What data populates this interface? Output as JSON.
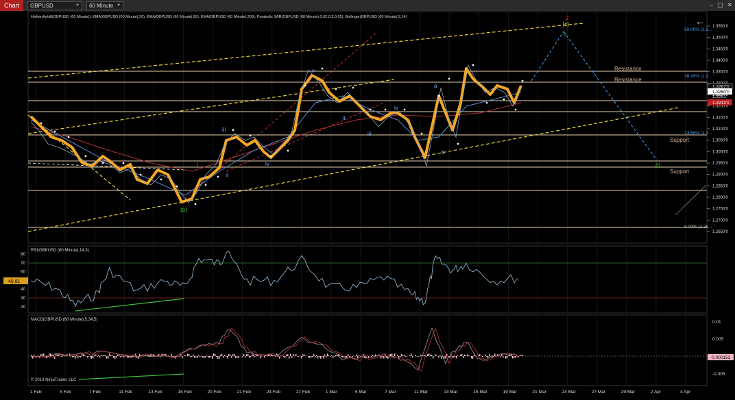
{
  "app": {
    "title": "Chart",
    "instrument": "GBPUSD",
    "interval": "60 Minute",
    "copyright": "© 2019 NinjaTrader, LLC"
  },
  "panels": {
    "price": {
      "indicators_label": "HeikenAshi8(GBPUSD (60 Minute)), EMA(GBPUSD (60 Minute),20), EMA(GBPUSD (60 Minute),50), EMA(GBPUSD (60 Minute),200), Parabolic SAR(GBPUSD (60 Minute),0.02,0.2,0.02), Bollinger(GBPUSD (60 Minute),2,14)",
      "y_ticks": [
        "1.3550'0",
        "1.3500'0",
        "1.3450'0",
        "1.3400'0",
        "1.3350'0",
        "1.3300'0",
        "1.3250'0",
        "1.3200'0",
        "1.3150'0",
        "1.3100'0",
        "1.3050'0",
        "1.3000'0",
        "1.2950'0",
        "1.2900'0",
        "1.2850'0",
        "1.2800'0",
        "1.2750'0",
        "1.2700'0",
        "1.2650'0"
      ],
      "y_range": [
        1.2625,
        1.358
      ],
      "price_tags": {
        "last": "1.3260'0",
        "ema": "1.3213'1",
        "top": "1.3267'0",
        "mid": "1.3251'"
      },
      "fib_labels": {
        "f50": "50.00% (1.3...",
        "f38": "38.20% (1.3...",
        "f23": "23.60% (1.3...",
        "f0": "0.00% (1.26..."
      },
      "sr_labels": {
        "r1": "Resistance",
        "r2": "Resistance",
        "s1": "Support",
        "s2": "Support"
      },
      "wave_labels": {
        "b": "(b)",
        "c": "[c]",
        "two": "2",
        "cc": "c",
        "i": "i",
        "ii": "ii",
        "iii": "iii",
        "iv": "iv",
        "v": "v",
        "a": "a",
        "bb": "b",
        "iii2": "iii",
        "iv2": "iv",
        "one": "(i)",
        "ii2": "ii"
      }
    },
    "rsi": {
      "label": "RSI(GBPUSD (60 Minute),14,3)",
      "y_ticks": [
        "80",
        "70",
        "60",
        "50",
        "40",
        "30",
        "20"
      ],
      "value_tag": "49.81"
    },
    "macd": {
      "label": "MACD(GBPUSD (60 Minute),5,34,5)",
      "y_ticks": [
        "0.01",
        "0.005",
        "0",
        "-0.005"
      ],
      "value_tag": "-0.000152"
    }
  },
  "x_axis": {
    "labels": [
      "1 Feb",
      "5 Feb",
      "7 Feb",
      "11 Feb",
      "13 Feb",
      "15 Feb",
      "20 Feb",
      "21 Feb",
      "24 Feb",
      "27 Feb",
      "1 Mar",
      "5 Mar",
      "7 Mar",
      "11 Mar",
      "13 Mar",
      "15 Mar",
      "19 Mar",
      "21 Mar",
      "24 Mar",
      "27 Mar",
      "29 Mar",
      "2 Apr",
      "4 Apr"
    ]
  },
  "colors": {
    "bg": "#000000",
    "grid": "#1c1c1c",
    "channel_yellow": "#e6d43a",
    "resist_line": "#e8cfae",
    "fib_blue": "#4aa3ff",
    "red_channel": "#c03030",
    "heiken_orange": "#f5a623",
    "rsi_line": "#8ab0cc",
    "macd_hist": "#f7bcc7"
  }
}
